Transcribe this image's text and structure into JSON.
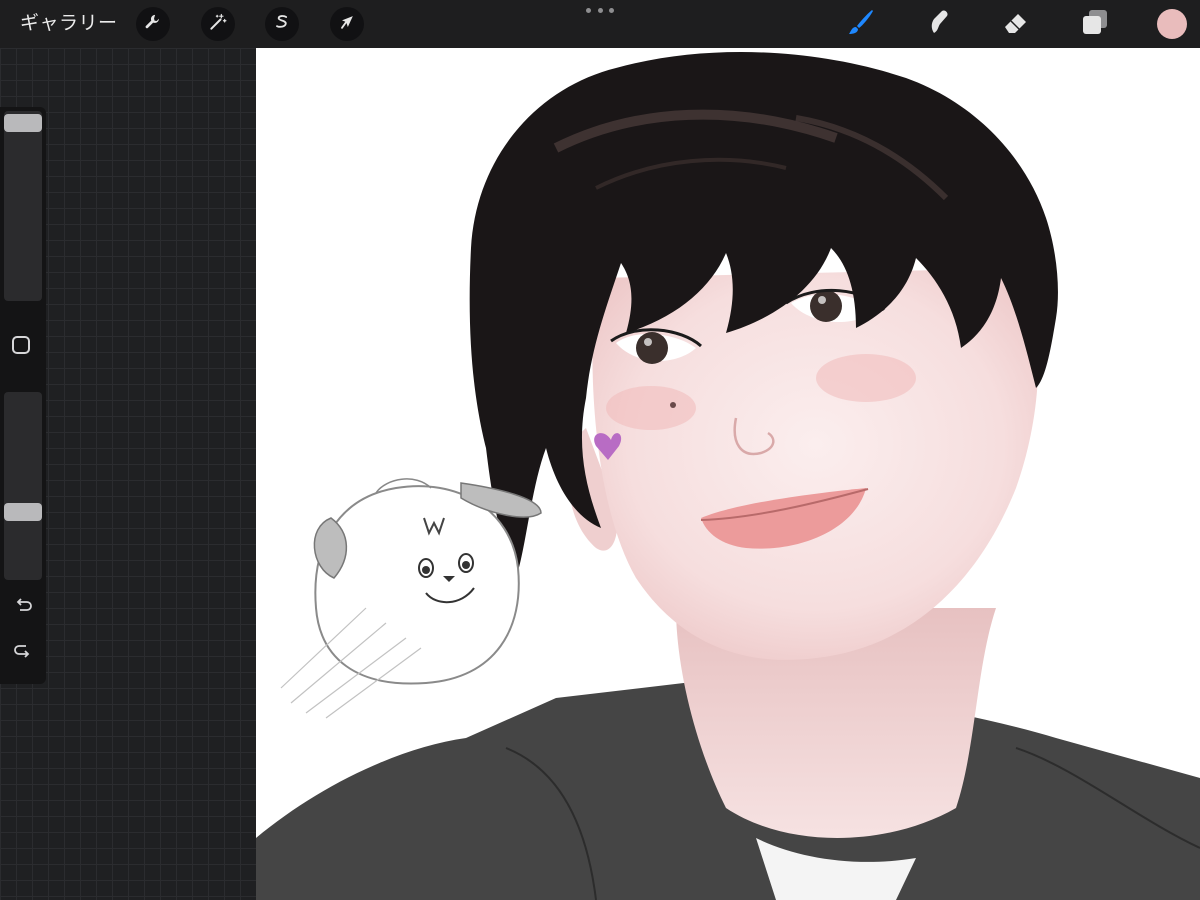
{
  "toolbar": {
    "gallery_label": "ギャラリー",
    "left_tools": [
      {
        "name": "actions",
        "icon": "wrench-icon"
      },
      {
        "name": "adjustments",
        "icon": "magic-wand-icon"
      },
      {
        "name": "selection",
        "icon": "selection-s-icon"
      },
      {
        "name": "transform",
        "icon": "arrow-cursor-icon"
      }
    ],
    "more_icon": "more-dots-icon",
    "right_tools": [
      {
        "name": "brush",
        "icon": "brush-icon",
        "active": true,
        "color": "#1e88ff"
      },
      {
        "name": "smudge",
        "icon": "smudge-icon",
        "active": false
      },
      {
        "name": "eraser",
        "icon": "eraser-icon",
        "active": false
      },
      {
        "name": "layers",
        "icon": "layers-icon",
        "active": false
      }
    ],
    "current_color": "#e9bcbc"
  },
  "sidebar": {
    "brush_size_level": 0.98,
    "opacity_level": 0.35,
    "modify_icon": "square-modify-icon",
    "undo_icon": "undo-icon",
    "redo_icon": "redo-icon"
  },
  "canvas": {
    "background": "#ffffff",
    "artwork": "digital-portrait"
  },
  "colors": {
    "toolbar_bg": "#1e1e1f",
    "accent_blue": "#1e88ff",
    "grid_bg": "#1f2022"
  }
}
